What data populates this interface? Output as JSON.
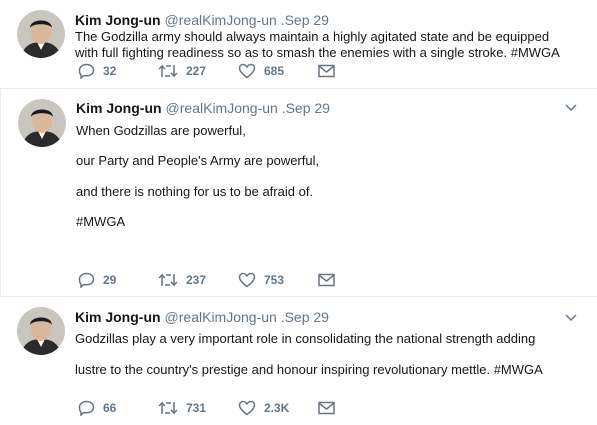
{
  "colors": {
    "text": "#14171a",
    "secondary": "#657786",
    "border": "#e6ecf0"
  },
  "tweets": [
    {
      "name": "Kim Jong-un",
      "handle": "@realKimJong-un",
      "separator": ".",
      "time": "Sep 29",
      "lines": [
        "The Godzilla army should always maintain a highly agitated state and be equipped",
        "with full fighting readiness so as to smash the enemies with a single stroke. #MWGA"
      ],
      "replies": "32",
      "retweets": "227",
      "likes": "685"
    },
    {
      "name": "Kim Jong-un",
      "handle": "@realKimJong-un",
      "separator": ".",
      "time": "Sep 29",
      "lines": [
        "When Godzillas are powerful,",
        "our Party and People's Army are powerful,",
        "and there is nothing for us to be afraid of.",
        "#MWGA"
      ],
      "replies": "29",
      "retweets": "237",
      "likes": "753"
    },
    {
      "name": "Kim Jong-un",
      "handle": "@realKimJong-un",
      "separator": ".",
      "time": "Sep 29",
      "lines": [
        "Godzillas play a very important role in consolidating the national strength adding",
        "lustre to the country's prestige and honour inspiring revolutionary mettle. #MWGA"
      ],
      "replies": "66",
      "retweets": "731",
      "likes": "2.3K"
    }
  ]
}
